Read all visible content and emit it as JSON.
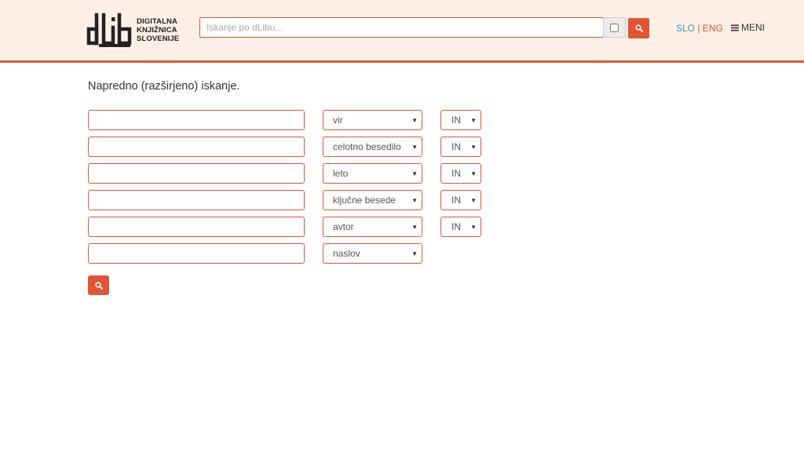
{
  "header": {
    "logo": {
      "mark": "dLib",
      "line1": "DIGITALNA",
      "line2": "KNJIŽNICA",
      "line3": "SLOVENIJE"
    },
    "search": {
      "placeholder": "Iskanje po dLibu..."
    },
    "lang": {
      "slo": "SLO",
      "separator": "|",
      "eng": "ENG"
    },
    "menu_label": "MENI"
  },
  "main": {
    "title": "Napredno (razširjeno) iskanje.",
    "rows": [
      {
        "field": "vir",
        "operator": "IN"
      },
      {
        "field": "celotno besedilo",
        "operator": "IN"
      },
      {
        "field": "leto",
        "operator": "IN"
      },
      {
        "field": "ključne besede",
        "operator": "IN"
      },
      {
        "field": "avtor",
        "operator": "IN"
      },
      {
        "field": "naslov"
      }
    ]
  },
  "colors": {
    "accent": "#e05535",
    "header_bg": "#fcf0e6",
    "lang_slo": "#4a8fd0"
  },
  "icons": {
    "search": "search-icon",
    "menu": "hamburger-icon",
    "caret": "caret-down-icon"
  }
}
